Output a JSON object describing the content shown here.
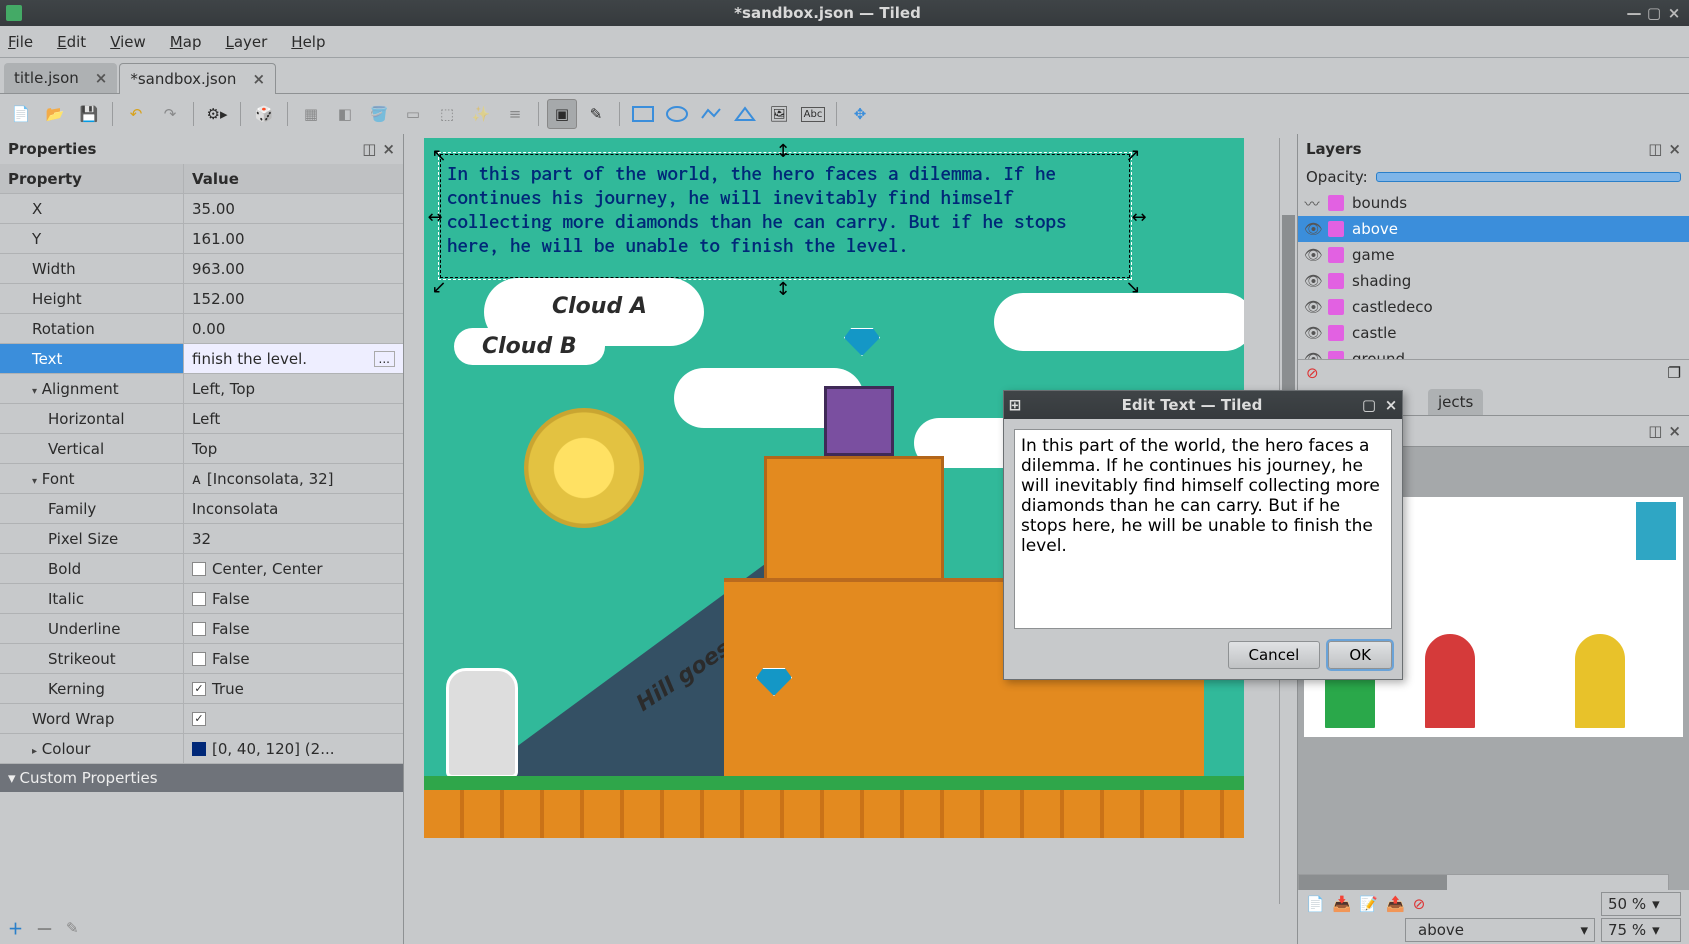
{
  "window": {
    "title": "*sandbox.json — Tiled",
    "min": "—",
    "max": "▢",
    "close": "×"
  },
  "menu": {
    "file": "File",
    "edit": "Edit",
    "view": "View",
    "map": "Map",
    "layer": "Layer",
    "help": "Help"
  },
  "tabs": [
    {
      "label": "title.json",
      "close": "×"
    },
    {
      "label": "*sandbox.json",
      "close": "×",
      "active": true
    }
  ],
  "properties": {
    "title": "Properties",
    "headers": {
      "prop": "Property",
      "val": "Value"
    },
    "rows": [
      {
        "k": "X",
        "v": "35.00",
        "indent": 1
      },
      {
        "k": "Y",
        "v": "161.00",
        "indent": 1
      },
      {
        "k": "Width",
        "v": "963.00",
        "indent": 1
      },
      {
        "k": "Height",
        "v": "152.00",
        "indent": 1
      },
      {
        "k": "Rotation",
        "v": "0.00",
        "indent": 1
      },
      {
        "k": "Text",
        "v": "finish the level.",
        "indent": 1,
        "selected": true,
        "ellipsis": "..."
      },
      {
        "k": "Alignment",
        "v": "Left, Top",
        "indent": 1,
        "expand": true
      },
      {
        "k": "Horizontal",
        "v": "Left",
        "indent": 2
      },
      {
        "k": "Vertical",
        "v": "Top",
        "indent": 2
      },
      {
        "k": "Font",
        "v": "[Inconsolata, 32]",
        "indent": 1,
        "expand": true,
        "prefix": "ᴀ"
      },
      {
        "k": "Family",
        "v": "Inconsolata",
        "indent": 2
      },
      {
        "k": "Pixel Size",
        "v": "32",
        "indent": 2
      },
      {
        "k": "Bold",
        "v": "Center, Center",
        "indent": 2,
        "check": false
      },
      {
        "k": "Italic",
        "v": "False",
        "indent": 2,
        "check": false
      },
      {
        "k": "Underline",
        "v": "False",
        "indent": 2,
        "check": false
      },
      {
        "k": "Strikeout",
        "v": "False",
        "indent": 2,
        "check": false
      },
      {
        "k": "Kerning",
        "v": "True",
        "indent": 2,
        "check": true
      },
      {
        "k": "Word Wrap",
        "v": "",
        "indent": 1,
        "check": true
      },
      {
        "k": "Colour",
        "v": "[0, 40, 120] (2...",
        "indent": 1,
        "collapsed": true,
        "swatch": true
      }
    ],
    "custom": "Custom Properties"
  },
  "layers": {
    "title": "Layers",
    "opacity_label": "Opacity:",
    "items": [
      {
        "name": "bounds",
        "hidden": true
      },
      {
        "name": "above",
        "selected": true
      },
      {
        "name": "game"
      },
      {
        "name": "shading"
      },
      {
        "name": "castledeco"
      },
      {
        "name": "castle"
      },
      {
        "name": "ground",
        "partial": true
      }
    ],
    "objects_tab": "jects"
  },
  "tileset": {
    "combo_layer": "above",
    "zoom_ts": "50 %",
    "zoom_map": "75 %"
  },
  "dialog": {
    "title": "Edit Text — Tiled",
    "text": "In this part of the world, the hero faces a dilemma. If he continues his journey, he will inevitably find himself collecting more diamonds than he can carry. But if he stops here, he will be unable to finish the level.",
    "cancel": "Cancel",
    "ok": "OK"
  },
  "canvas": {
    "text": "In this part of the world, the hero faces a dilemma. If he continues his journey, he will inevitably find himself collecting more diamonds than he can carry. But if he stops here, he will be unable to finish the level.",
    "cloudA": "Cloud A",
    "cloudB": "Cloud B",
    "hill": "Hill goes up here..."
  }
}
